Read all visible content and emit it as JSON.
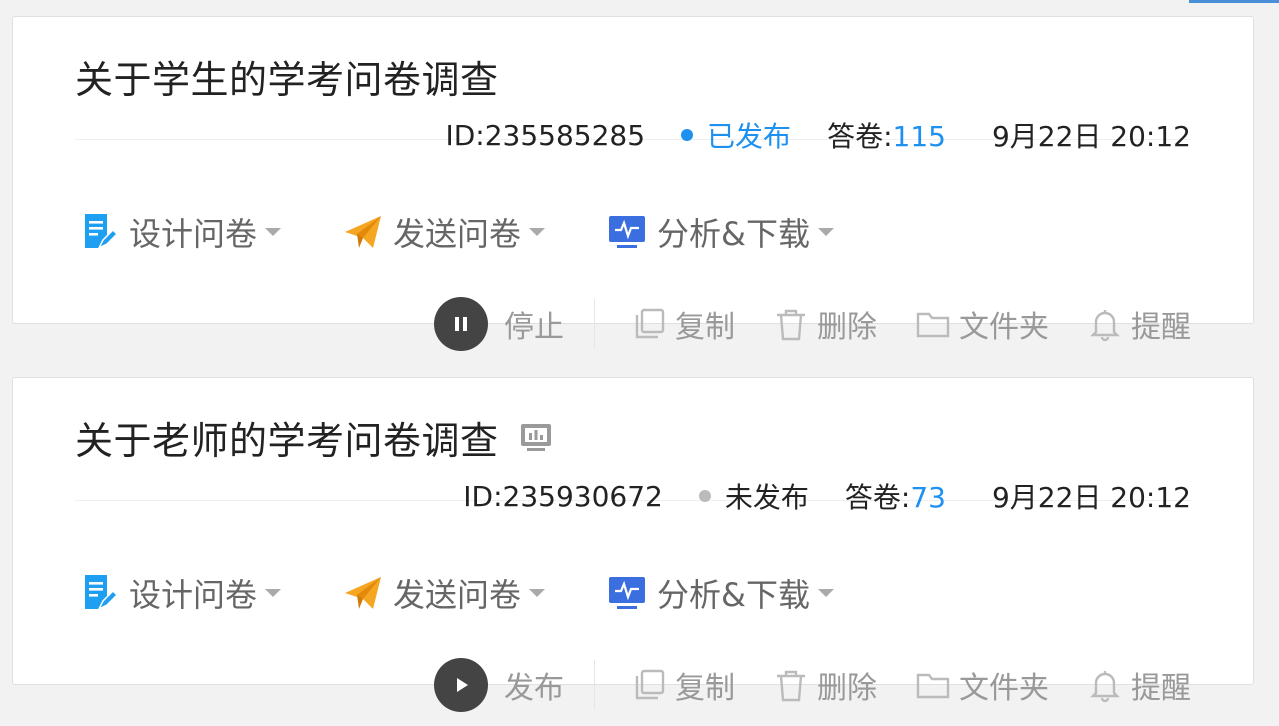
{
  "surveys": [
    {
      "title": "关于学生的学考问卷调查",
      "has_title_icon": false,
      "id_text": "ID:235585285",
      "status": "已发布",
      "status_color": "#1e90f0",
      "answers_label": "答卷:",
      "answers_count": "115",
      "datetime": "9月22日 20:12",
      "actions": {
        "design": "设计问卷",
        "send": "发送问卷",
        "analyze": "分析&下载"
      },
      "run_label": "停止",
      "run_icon": "pause-icon",
      "tools": {
        "copy": "复制",
        "delete": "删除",
        "folder": "文件夹",
        "remind": "提醒"
      }
    },
    {
      "title": "关于老师的学考问卷调查",
      "has_title_icon": true,
      "title_icon": "presentation-chart-icon",
      "id_text": "ID:235930672",
      "status": "未发布",
      "status_color": "#bbbbbb",
      "answers_label": "答卷:",
      "answers_count": "73",
      "datetime": "9月22日 20:12",
      "actions": {
        "design": "设计问卷",
        "send": "发送问卷",
        "analyze": "分析&下载"
      },
      "run_label": "发布",
      "run_icon": "play-icon",
      "tools": {
        "copy": "复制",
        "delete": "删除",
        "folder": "文件夹",
        "remind": "提醒"
      }
    }
  ],
  "colors": {
    "link_blue": "#1e90f0",
    "design_icon": "#1e9ff2",
    "send_icon": "#f5a623",
    "analyze_icon": "#3b6fe0",
    "run_button": "#444444"
  }
}
